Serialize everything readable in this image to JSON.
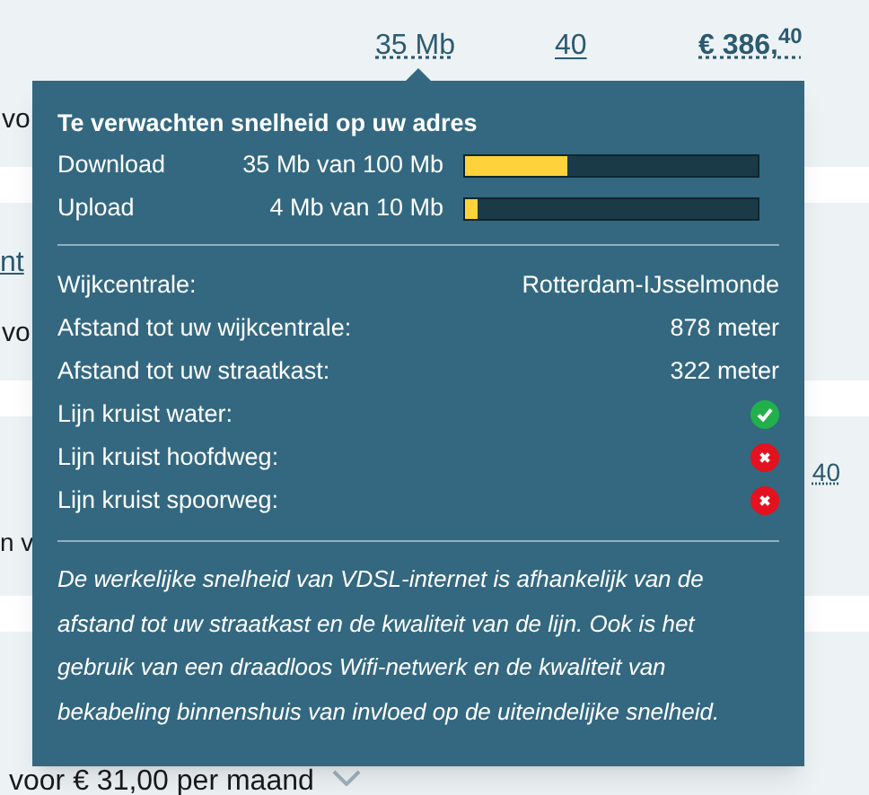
{
  "header": {
    "speed": "35 Mb",
    "contracts": "40",
    "price": "€ 386,$^{40}$"
  },
  "offers": [
    {
      "note": "vo"
    },
    {
      "link": "nt",
      "note": "vo"
    },
    {
      "price_fragment": "40",
      "note": "n v"
    }
  ],
  "last_offer": {
    "note": "voor € 31,00 per maand"
  },
  "tooltip": {
    "title": "Te verwachten snelheid op uw adres",
    "speeds": [
      {
        "label": "Download",
        "reading": "35 Mb van 100 Mb",
        "level": 0.35
      },
      {
        "label": "Upload",
        "reading": "4 Mb van 10 Mb",
        "level": 0.04
      }
    ],
    "details": [
      {
        "kind": "text",
        "label": "Wijkcentrale:",
        "value": "Rotterdam-IJsselmonde"
      },
      {
        "kind": "text",
        "label": "Afstand tot uw wijkcentrale:",
        "value": "878 meter"
      },
      {
        "kind": "text",
        "label": "Afstand tot uw straatkast:",
        "value": "322 meter"
      },
      {
        "kind": "check",
        "label": "Lijn kruist water:",
        "checked": true
      },
      {
        "kind": "check",
        "label": "Lijn kruist hoofdweg:",
        "checked": false
      },
      {
        "kind": "check",
        "label": "Lijn kruist spoorweg:",
        "checked": false
      }
    ],
    "note": "De werkelijke snelheid van VDSL-internet is afhankelijk van de afstand tot uw straatkast en de kwaliteit van de lijn. Ook is het gebruik van een draadloos Wifi-netwerk en de kwaliteit van bekabeling binnenshuis van invloed op de uiteindelijke snelheid."
  }
}
